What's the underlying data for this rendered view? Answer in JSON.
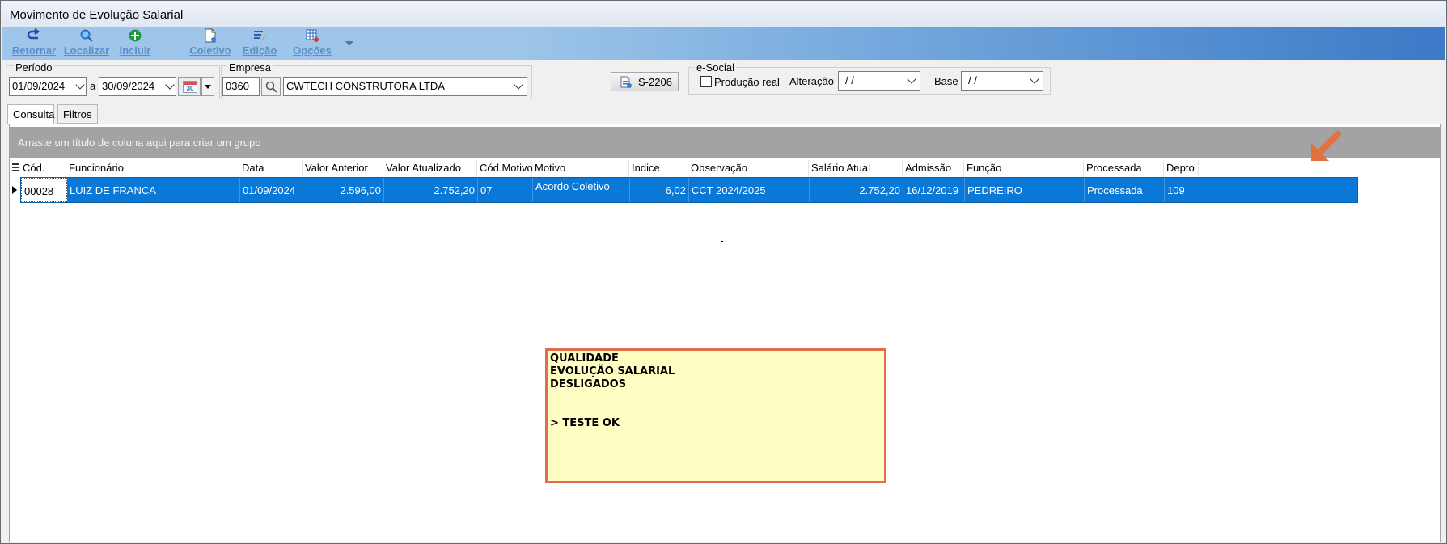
{
  "window": {
    "title": "Movimento de Evolução Salarial"
  },
  "toolbar": {
    "retornar": "Retornar",
    "localizar": "Localizar",
    "incluir": "Incluir",
    "coletivo": "Coletivo",
    "edicao": "Edição",
    "opcoes": "Opções"
  },
  "filters": {
    "periodo_label": "Período",
    "date_from": "01/09/2024",
    "separator": "a",
    "date_to": "30/09/2024",
    "calendar_icon_text": "30",
    "empresa_label": "Empresa",
    "empresa_code": "0360",
    "empresa_name": "CWTECH CONSTRUTORA LTDA",
    "s2206_label": "S-2206",
    "esocial_label": "e-Social",
    "producao_real_label": "Produção real",
    "alteracao_label": "Alteração",
    "alteracao_value": "/ /",
    "base_label": "Base",
    "base_value": "/ /"
  },
  "tabs": [
    "Consulta",
    "Filtros"
  ],
  "grid": {
    "group_hint": "Arraste um título de coluna aqui para criar um grupo",
    "columns": [
      "Cód.",
      "Funcionário",
      "Data",
      "Valor Anterior",
      "Valor Atualizado",
      "Cód.Motivo",
      "Motivo",
      "Indice",
      "Observação",
      "Salário Atual",
      "Admissão",
      "Função",
      "Processada",
      "Depto"
    ],
    "rows": [
      [
        "00028",
        "LUIZ DE FRANCA",
        "01/09/2024",
        "2.596,00",
        "2.752,20",
        "07",
        "Acordo Coletivo",
        "6,02",
        "CCT 2024/2025",
        "2.752,20",
        "16/12/2019",
        "PEDREIRO",
        "Processada",
        "109"
      ]
    ]
  },
  "note": {
    "line1": "QUALIDADE",
    "line2": "EVOLUÇÃO SALARIAL",
    "line3": "DESLIGADOS",
    "line4": "> TESTE OK"
  },
  "colors": {
    "selection": "#0a78d7",
    "annotation_arrow": "#e4703c",
    "note_bg": "#ffffc4",
    "note_border": "#e06e4a"
  }
}
